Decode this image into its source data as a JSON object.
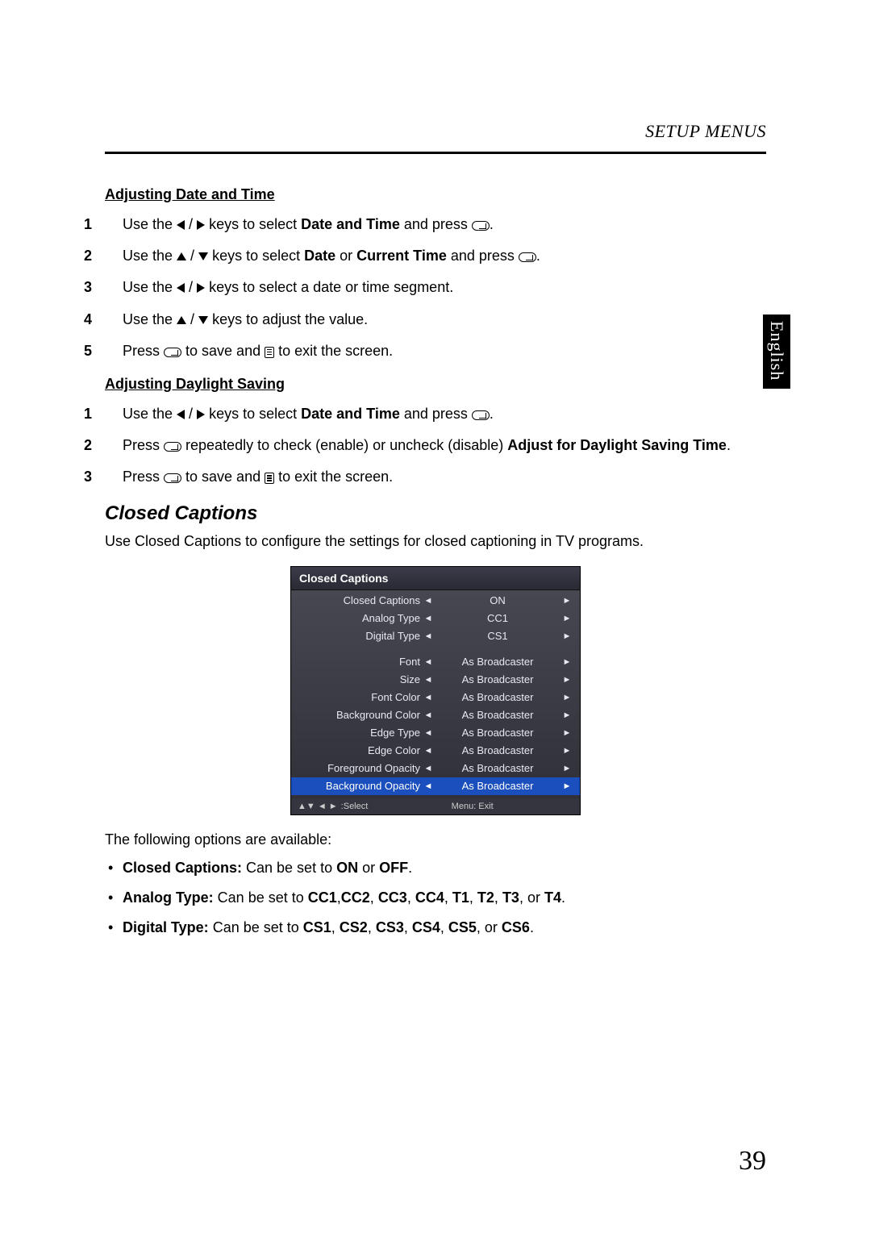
{
  "header": {
    "title": "SETUP MENUS"
  },
  "language_tab": "English",
  "sections": {
    "adj_date_time": {
      "heading": "Adjusting Date and Time",
      "steps": {
        "s1a": "Use the ",
        "s1b": " keys to select ",
        "s1c": "Date and Time",
        "s1d": " and press ",
        "s2a": "Use the ",
        "s2b": " keys to select ",
        "s2c": "Date",
        "s2d": " or ",
        "s2e": "Current Time",
        "s2f": " and press ",
        "s3a": "Use the ",
        "s3b": " keys to select a date or time segment.",
        "s4a": "Use the ",
        "s4b": " keys to adjust the value.",
        "s5a": "Press ",
        "s5b": " to save and ",
        "s5c": " to exit the screen."
      }
    },
    "adj_daylight": {
      "heading": "Adjusting Daylight Saving",
      "steps": {
        "s1a": "Use the ",
        "s1b": " keys to select ",
        "s1c": "Date and Time",
        "s1d": " and press ",
        "s2a": "Press ",
        "s2b": " repeatedly to check (enable) or uncheck (disable) ",
        "s2c": "Adjust for Daylight Saving Time",
        "s3a": "Press ",
        "s3b": " to save and ",
        "s3c": " to exit the screen."
      }
    },
    "closed_captions": {
      "title": "Closed Captions",
      "intro": "Use Closed Captions to configure the settings for closed captioning in TV programs.",
      "outro": "The following options are available:",
      "bullets": {
        "b1a": "Closed Captions:",
        "b1b": " Can be set to ",
        "b1c": "ON",
        "b1d": " or ",
        "b1e": "OFF",
        "b2a": "Analog Type:",
        "b2b": " Can be set to ",
        "b2c": "CC1",
        "b2d": "CC2",
        "b2e": "CC3",
        "b2f": "CC4",
        "b2g": "T1",
        "b2h": "T2",
        "b2i": "T3",
        "b2j": "T4",
        "b3a": "Digital Type:",
        "b3b": " Can be set to ",
        "b3c": "CS1",
        "b3d": "CS2",
        "b3e": "CS3",
        "b3f": "CS4",
        "b3g": "CS5",
        "b3h": "CS6"
      }
    }
  },
  "menu_panel": {
    "title": "Closed Captions",
    "rows": [
      {
        "label": "Closed Captions",
        "value": "ON"
      },
      {
        "label": "Analog Type",
        "value": "CC1"
      },
      {
        "label": "Digital Type",
        "value": "CS1"
      },
      {
        "label": "Font",
        "value": "As Broadcaster"
      },
      {
        "label": "Size",
        "value": "As Broadcaster"
      },
      {
        "label": "Font Color",
        "value": "As Broadcaster"
      },
      {
        "label": "Background Color",
        "value": "As Broadcaster"
      },
      {
        "label": "Edge Type",
        "value": "As Broadcaster"
      },
      {
        "label": "Edge Color",
        "value": "As Broadcaster"
      },
      {
        "label": "Foreground Opacity",
        "value": "As Broadcaster"
      },
      {
        "label": "Background Opacity",
        "value": "As Broadcaster",
        "selected": true
      }
    ],
    "footer": {
      "select": ":Select",
      "menu_exit": "Menu: Exit"
    }
  },
  "page_number": "39"
}
